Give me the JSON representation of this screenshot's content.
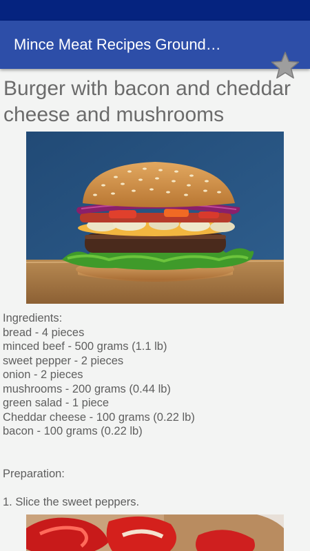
{
  "app_bar": {
    "title": "Mince Meat Recipes Ground…",
    "favorite_icon": "star-icon"
  },
  "recipe": {
    "title": "Burger with bacon and cheddar cheese and mushrooms",
    "ingredients_heading": "Ingredients:",
    "ingredients": [
      "bread - 4 pieces",
      "minced beef - 500 grams (1.1 lb)",
      "sweet pepper - 2 pieces",
      "onion - 2 pieces",
      "mushrooms - 200 grams (0.44 lb)",
      "green salad - 1 piece",
      "Cheddar cheese - 100 grams (0.22 lb)",
      "bacon - 100 grams (0.22 lb)"
    ],
    "preparation_heading": "Preparation:",
    "steps": [
      "1. Slice the sweet peppers."
    ]
  },
  "colors": {
    "status_bar": "#05237f",
    "app_bar": "#2d4ea8",
    "background": "#f3f4f3",
    "text": "#5e5e5e"
  }
}
